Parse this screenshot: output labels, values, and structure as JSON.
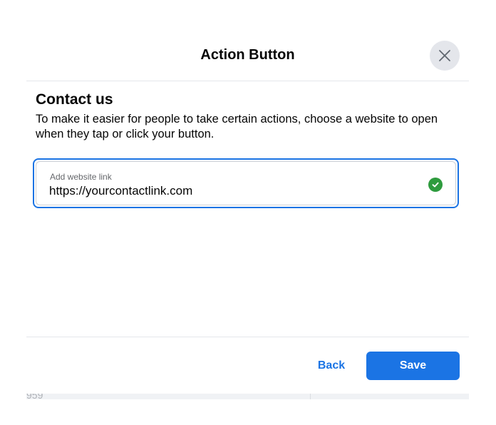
{
  "modal": {
    "title": "Action Button",
    "close_icon": "close-icon"
  },
  "section": {
    "heading": "Contact us",
    "description": "To make it easier for people to take certain actions, choose a website to open when they tap or click your button."
  },
  "website_field": {
    "label": "Add website link",
    "value": "https://yourcontactlink.com",
    "status_icon": "check-circle-icon",
    "status_color": "#2e9b3e",
    "focus_color": "#1b74e4"
  },
  "footer": {
    "back_label": "Back",
    "save_label": "Save"
  },
  "underlay": {
    "partial_text": "959"
  },
  "colors": {
    "accent": "#1b74e4",
    "close_bg": "#e4e6eb",
    "text_primary": "#050505",
    "text_secondary": "#65676b"
  }
}
